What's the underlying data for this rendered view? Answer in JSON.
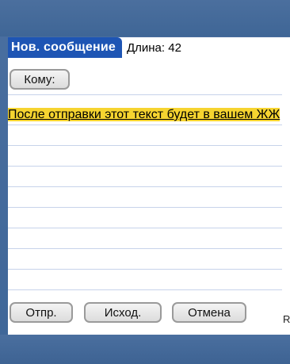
{
  "header": {
    "title": "Нов. сообщение",
    "length_label": "Длина: 42"
  },
  "compose": {
    "to_button": "Кому:",
    "message_text": "После отправки этот текст будет в вашем ЖЖ"
  },
  "actions": {
    "send": "Отпр.",
    "outbox": "Исход.",
    "cancel": "Отмена"
  },
  "edge_mark": "R",
  "colors": {
    "title_tab_bg": "#1e55b4",
    "highlight": "#f6d430",
    "frame": "#3e6698",
    "rule_lines": "#c7d3ea"
  }
}
